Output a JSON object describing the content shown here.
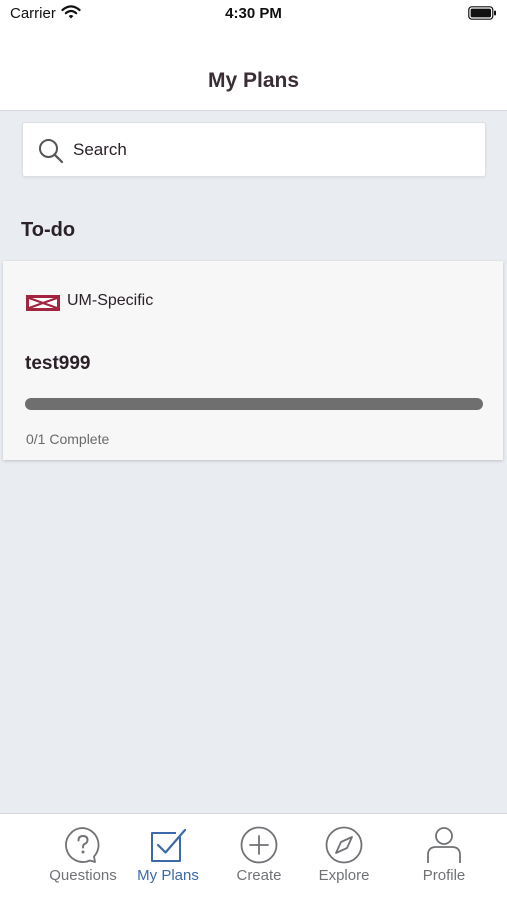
{
  "status_bar": {
    "carrier": "Carrier",
    "time": "4:30 PM"
  },
  "nav": {
    "title": "My Plans"
  },
  "search": {
    "placeholder": "Search"
  },
  "section": {
    "title": "To-do"
  },
  "plan": {
    "category": "UM-Specific",
    "name": "test999",
    "progress_text": "0/1 Complete",
    "progress_fraction": 0
  },
  "tabs": [
    {
      "label": "Questions",
      "icon": "question-bubble-icon",
      "active": false
    },
    {
      "label": "My Plans",
      "icon": "checkbox-icon",
      "active": true
    },
    {
      "label": "Create",
      "icon": "plus-circle-icon",
      "active": false
    },
    {
      "label": "Explore",
      "icon": "compass-icon",
      "active": false
    },
    {
      "label": "Profile",
      "icon": "person-icon",
      "active": false
    }
  ],
  "colors": {
    "accent": "#3b6aa8",
    "brand_red": "#a3243f",
    "background": "#e9ecf1",
    "progress_track": "#6f6f6f"
  }
}
